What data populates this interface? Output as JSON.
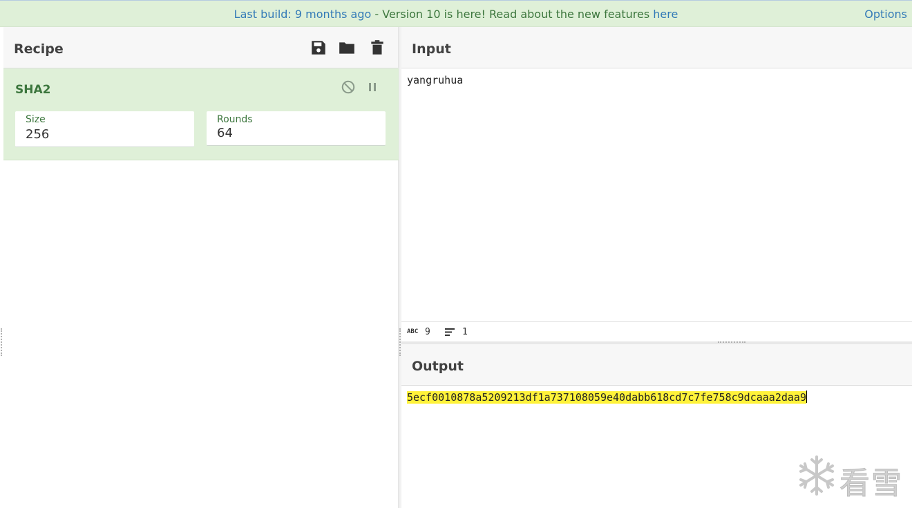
{
  "banner": {
    "last_build": "Last build: 9 months ago",
    "separator": " - ",
    "version_message": "Version 10 is here! Read about the new features ",
    "here_link": "here",
    "options": "Options"
  },
  "recipe": {
    "title": "Recipe",
    "save_icon": "save-icon",
    "load_icon": "folder-icon",
    "clear_icon": "trash-icon",
    "operation": {
      "name": "SHA2",
      "size_label": "Size",
      "size_value": "256",
      "rounds_label": "Rounds",
      "rounds_value": "64"
    }
  },
  "input": {
    "title": "Input",
    "text": "yangruhua",
    "status": {
      "length_icon": "abc-icon",
      "length": "9",
      "lines_icon": "lines-icon",
      "lines": "1"
    }
  },
  "output": {
    "title": "Output",
    "text": "5ecf0010878a5209213df1a737108059e40dabb618cd7c7fe758c9dcaaa2daa9"
  },
  "watermark": {
    "text": "看雪"
  },
  "colors": {
    "banner_bg": "#dff0d8",
    "op_bg": "#dff0d8",
    "op_text": "#3c763d",
    "link": "#337ab7",
    "highlight": "#fff23a"
  }
}
